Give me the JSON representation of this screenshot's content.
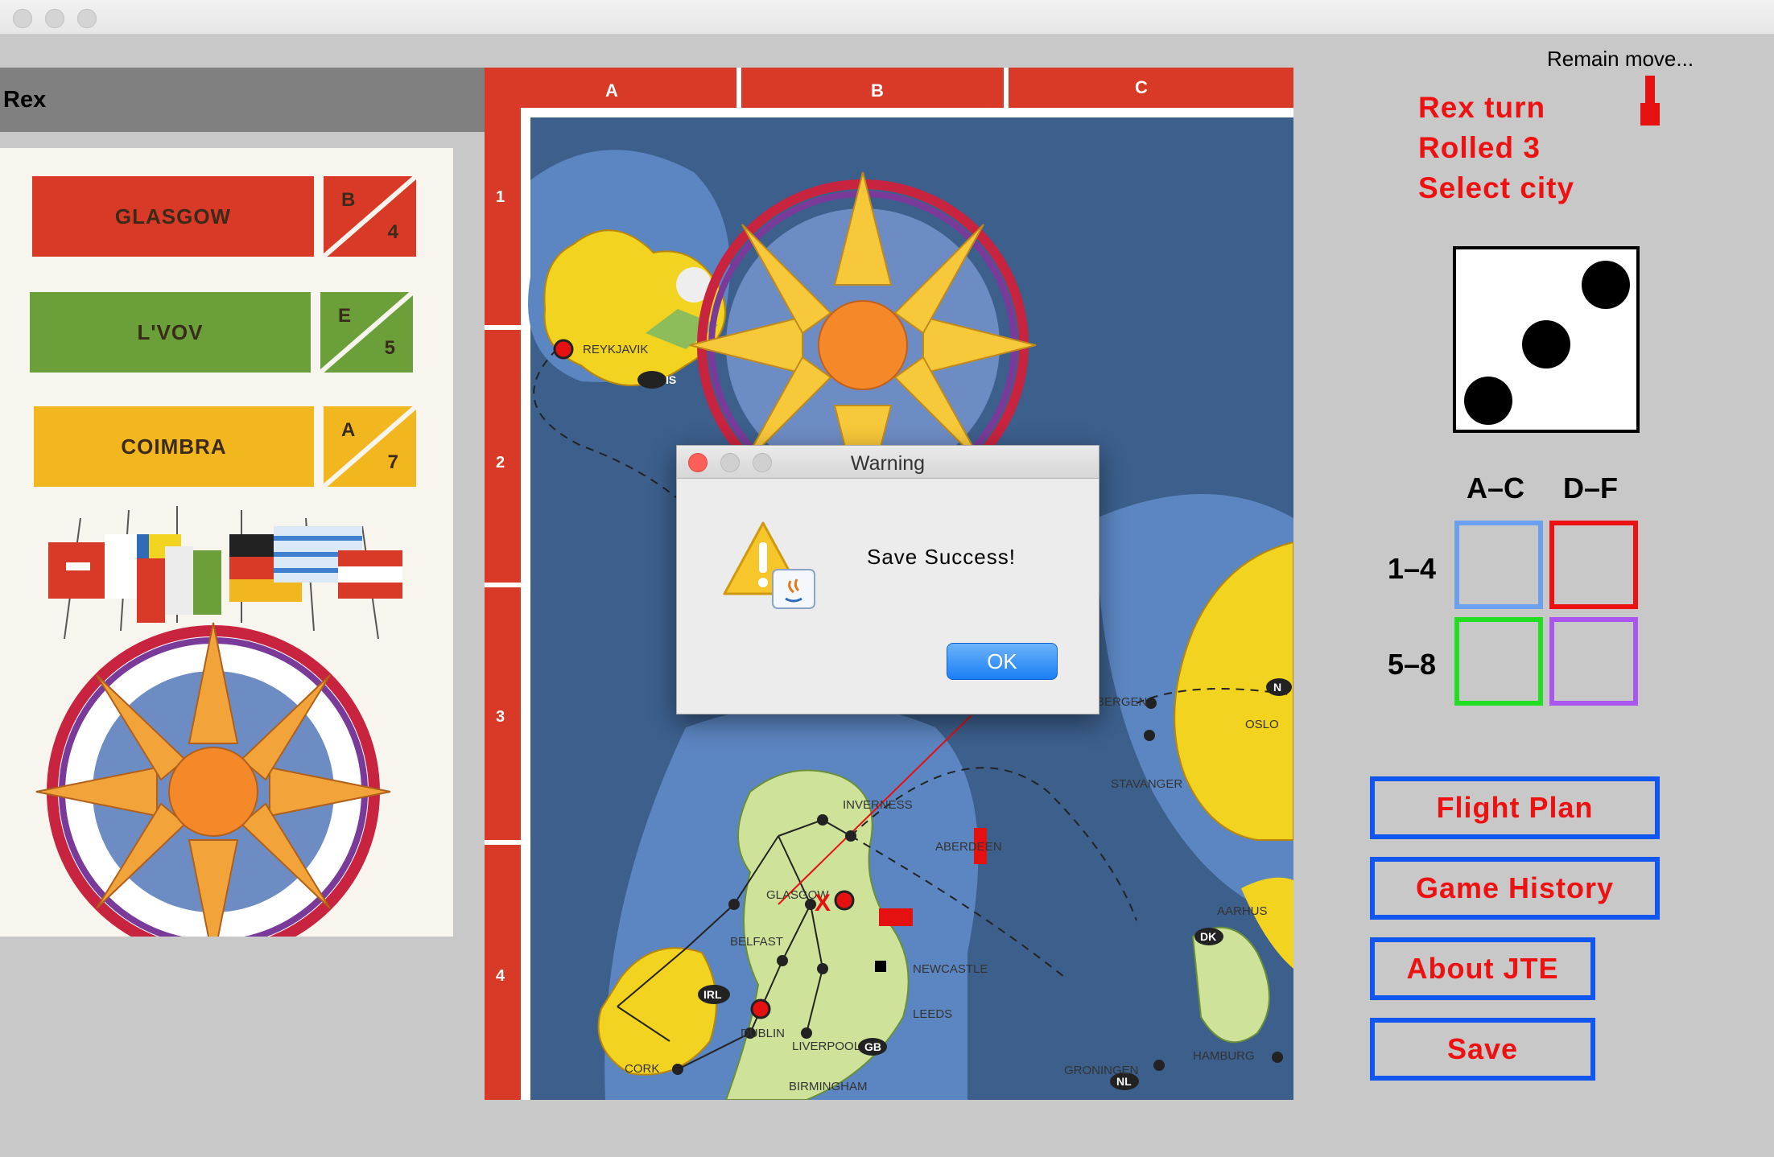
{
  "player": {
    "name": "Rex"
  },
  "cards": [
    {
      "city": "GLASGOW",
      "letter": "B",
      "number": "4",
      "color": "#d93a28"
    },
    {
      "city": "L'VOV",
      "letter": "E",
      "number": "5",
      "color": "#6a9f3a"
    },
    {
      "city": "COIMBRA",
      "letter": "A",
      "number": "7",
      "color": "#f2b61f"
    }
  ],
  "map": {
    "columns": [
      "A",
      "B",
      "C"
    ],
    "rows": [
      "1",
      "2",
      "3",
      "4"
    ],
    "cities": [
      "REYKJAVIK",
      "INVERNESS",
      "ABERDEEN",
      "GLASGOW",
      "BELFAST",
      "NEWCASTLE",
      "DUBLIN",
      "LEEDS",
      "LIVERPOOL",
      "CORK",
      "BIRMINGHAM",
      "OSLO",
      "STAVANGER",
      "BERGEN",
      "AARHUS",
      "HAMBURG",
      "GRONINGEN"
    ],
    "country_codes": [
      "IS",
      "IRL",
      "GB",
      "N",
      "DK",
      "NL"
    ],
    "marker_x": "X"
  },
  "status": {
    "remain_label": "Remain move...",
    "turn": "Rex turn",
    "rolled": "Rolled 3",
    "instruction": "Select city",
    "die_value": 3
  },
  "quadrants": {
    "col_labels": [
      "A–C",
      "D–F"
    ],
    "row_labels": [
      "1–4",
      "5–8"
    ],
    "colors": [
      "#6aa0ee",
      "#ee1111",
      "#22dd22",
      "#aa55ee"
    ]
  },
  "buttons": {
    "flight_plan": "Flight Plan",
    "game_history": "Game History",
    "about": "About JTE",
    "save": "Save"
  },
  "dialog": {
    "title": "Warning",
    "message": "Save Success!",
    "ok": "OK"
  },
  "colors": {
    "accent_red": "#ee1111",
    "button_border": "#1256f2",
    "background": "#c8c8c8"
  }
}
